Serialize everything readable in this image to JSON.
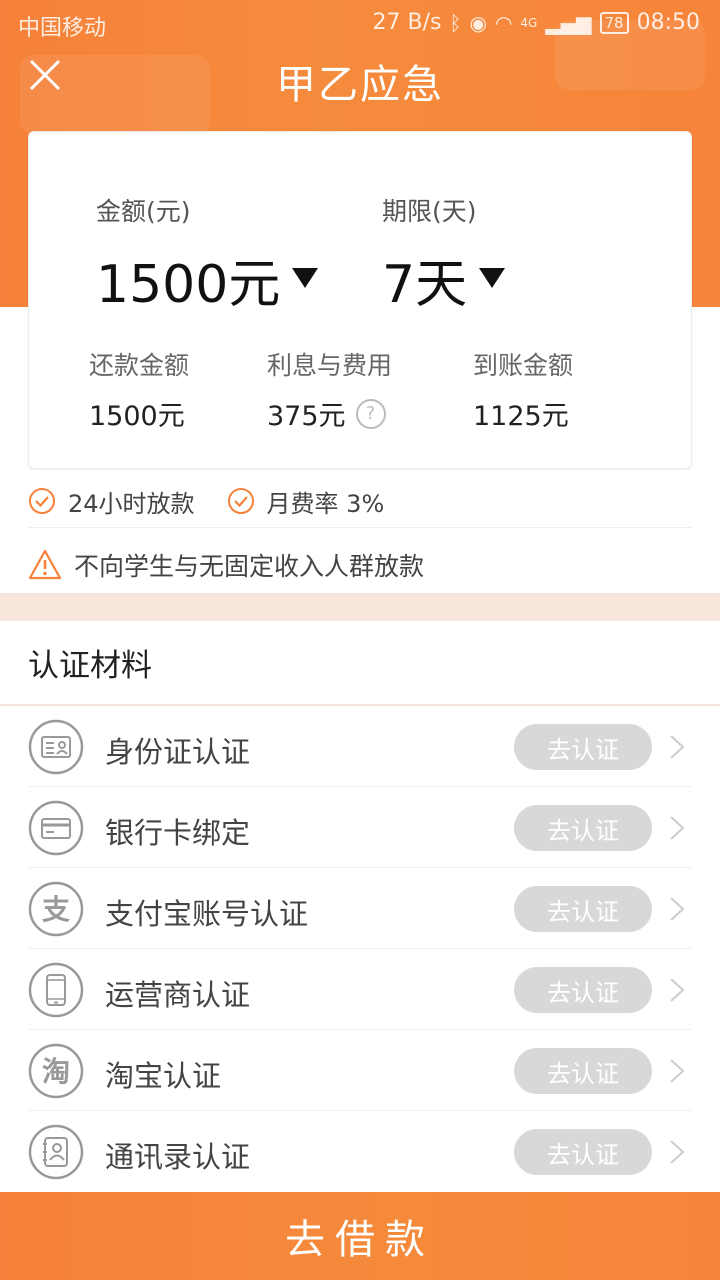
{
  "status_bar": {
    "carrier": "中国移动",
    "speed": "27 B/s",
    "network": "4G",
    "battery": "78",
    "time": "08:50"
  },
  "header": {
    "title": "甲乙应急"
  },
  "loan": {
    "amount_label": "金额(元)",
    "amount_value": "1500元",
    "term_label": "期限(天)",
    "term_value": "7天",
    "repay_label": "还款金额",
    "repay_value": "1500元",
    "fee_label": "利息与费用",
    "fee_value": "375元",
    "receive_label": "到账金额",
    "receive_value": "1125元"
  },
  "features": [
    "24小时放款",
    "月费率 3%"
  ],
  "warning": "不向学生与无固定收入人群放款",
  "section": {
    "title": "认证材料"
  },
  "auth_items": [
    {
      "label": "身份证认证",
      "button": "去认证",
      "icon": "id-card-icon"
    },
    {
      "label": "银行卡绑定",
      "button": "去认证",
      "icon": "bank-card-icon"
    },
    {
      "label": "支付宝账号认证",
      "button": "去认证",
      "icon": "alipay-icon",
      "glyph": "支"
    },
    {
      "label": "运营商认证",
      "button": "去认证",
      "icon": "phone-icon"
    },
    {
      "label": "淘宝认证",
      "button": "去认证",
      "icon": "taobao-icon",
      "glyph": "淘"
    },
    {
      "label": "通讯录认证",
      "button": "去认证",
      "icon": "contacts-icon"
    }
  ],
  "cta": {
    "label": "去借款"
  },
  "colors": {
    "brand": "#f6813a",
    "button_disabled": "#d8d8d8",
    "band": "#f7e6dc"
  }
}
